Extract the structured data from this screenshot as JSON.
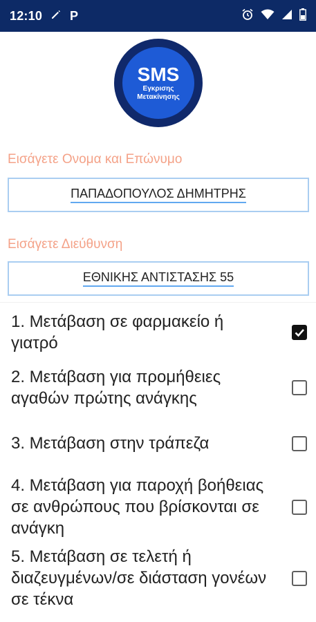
{
  "status": {
    "time": "12:10",
    "p_icon": "P"
  },
  "logo": {
    "title": "SMS",
    "line1": "Εγκρισης",
    "line2": "Μετακίνησης"
  },
  "name_field": {
    "label": "Εισάγετε Ονομα και Επώνυμο",
    "value": "ΠΑΠΑΔΟΠΟΥΛΟΣ ΔΗΜΗΤΡΗΣ"
  },
  "address_field": {
    "label": "Εισάγετε Διεύθυνση",
    "value": "ΕΘΝΙΚΗΣ ΑΝΤΙΣΤΑΣΗΣ 55"
  },
  "options": [
    {
      "text": "1. Μετάβαση σε φαρμακείο ή γιατρό",
      "checked": true
    },
    {
      "text": "2. Μετάβαση για προμήθειες αγαθών πρώτης ανάγκης",
      "checked": false
    },
    {
      "text": "3. Μετάβαση στην τράπεζα",
      "checked": false
    },
    {
      "text": "4. Μετάβαση για παροχή βοήθειας σε ανθρώπους που βρίσκονται σε ανάγκη",
      "checked": false
    },
    {
      "text": "5. Μετάβαση σε τελετή ή διαζευγμένων/σε διάσταση γονέων σε τέκνα",
      "checked": false
    }
  ]
}
